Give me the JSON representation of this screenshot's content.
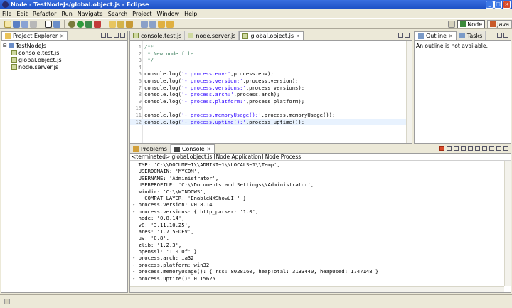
{
  "window": {
    "title": "Node - TestNodeJs/global.object.js - Eclipse",
    "title_color": "#1c4fc4"
  },
  "menu": [
    "File",
    "Edit",
    "Refactor",
    "Run",
    "Navigate",
    "Search",
    "Project",
    "Window",
    "Help"
  ],
  "perspectives": [
    {
      "label": "Node",
      "active": true
    },
    {
      "label": "Java",
      "active": false
    }
  ],
  "explorer": {
    "tab": "Project Explorer",
    "project": "TestNodeJs",
    "files": [
      "console.test.js",
      "global.object.js",
      "node.server.js"
    ]
  },
  "editor": {
    "tabs": [
      {
        "label": "console.test.js",
        "active": false
      },
      {
        "label": "node.server.js",
        "active": false
      },
      {
        "label": "global.object.js",
        "active": true
      }
    ],
    "lines": [
      {
        "no": "1",
        "parts": [
          {
            "t": "/**",
            "c": "cm"
          }
        ]
      },
      {
        "no": "2",
        "parts": [
          {
            "t": " * New node file",
            "c": "cm"
          }
        ]
      },
      {
        "no": "3",
        "parts": [
          {
            "t": " */",
            "c": "cm"
          }
        ]
      },
      {
        "no": "4",
        "parts": [
          {
            "t": "",
            "c": ""
          }
        ]
      },
      {
        "no": "5",
        "parts": [
          {
            "t": "console.log(",
            "c": ""
          },
          {
            "t": "'- process.env:'",
            "c": "st"
          },
          {
            "t": ",process.env);",
            "c": ""
          }
        ]
      },
      {
        "no": "6",
        "parts": [
          {
            "t": "console.log(",
            "c": ""
          },
          {
            "t": "'- process.version:'",
            "c": "st"
          },
          {
            "t": ",process.version);",
            "c": ""
          }
        ]
      },
      {
        "no": "7",
        "parts": [
          {
            "t": "console.log(",
            "c": ""
          },
          {
            "t": "'- process.versions:'",
            "c": "st"
          },
          {
            "t": ",process.versions);",
            "c": ""
          }
        ]
      },
      {
        "no": "8",
        "parts": [
          {
            "t": "console.log(",
            "c": ""
          },
          {
            "t": "'- process.arch:'",
            "c": "st"
          },
          {
            "t": ",process.arch);",
            "c": ""
          }
        ]
      },
      {
        "no": "9",
        "parts": [
          {
            "t": "console.log(",
            "c": ""
          },
          {
            "t": "'- process.platform:'",
            "c": "st"
          },
          {
            "t": ",process.platform);",
            "c": ""
          }
        ]
      },
      {
        "no": "10",
        "parts": [
          {
            "t": "",
            "c": ""
          }
        ]
      },
      {
        "no": "11",
        "parts": [
          {
            "t": "console.log(",
            "c": ""
          },
          {
            "t": "'- process.memoryUsage():'",
            "c": "st"
          },
          {
            "t": ",process.memoryUsage());",
            "c": ""
          }
        ]
      },
      {
        "no": "12",
        "parts": [
          {
            "t": "console.log(",
            "c": ""
          },
          {
            "t": "'- process.uptime():'",
            "c": "st"
          },
          {
            "t": ",process.uptime());",
            "c": ""
          }
        ],
        "highlight": true
      }
    ]
  },
  "outline": {
    "tabs": [
      "Outline",
      "Tasks"
    ],
    "message": "An outline is not available."
  },
  "console": {
    "tabs": [
      "Problems",
      "Console"
    ],
    "info": "<terminated> global.object.js [Node Application] Node Process",
    "lines": [
      "  TMP: 'C:\\\\DOCUME~1\\\\ADMINI~1\\\\LOCALS~1\\\\Temp',",
      "  USERDOMAIN: 'MYCOM',",
      "  USERNAME: 'Administrator',",
      "  USERPROFILE: 'C:\\\\Documents and Settings\\\\Administrator',",
      "  windir: 'C:\\\\WINDOWS',",
      "  __COMPAT_LAYER: 'EnableNXShowUI ' }",
      "- process.version: v0.8.14",
      "- process.versions: { http_parser: '1.0',",
      "  node: '0.8.14',",
      "  v8: '3.11.10.25',",
      "  ares: '1.7.5-DEV',",
      "  uv: '0.8',",
      "  zlib: '1.2.3',",
      "  openssl: '1.0.0f' }",
      "- process.arch: ia32",
      "- process.platform: win32",
      "- process.memoryUsage(): { rss: 8028160, heapTotal: 3133440, heapUsed: 1747148 }",
      "- process.uptime(): 0.15625"
    ]
  }
}
